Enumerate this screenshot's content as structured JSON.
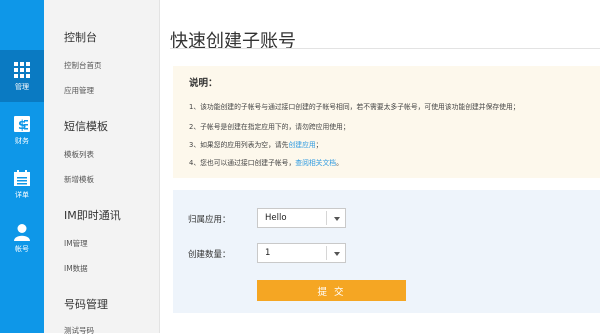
{
  "rail": {
    "items": [
      {
        "label": "管理",
        "icon": "grid-icon"
      },
      {
        "label": "财务",
        "icon": "dollar-icon"
      },
      {
        "label": "详单",
        "icon": "calendar-list-icon"
      },
      {
        "label": "帐号",
        "icon": "user-icon"
      }
    ]
  },
  "sidebar": {
    "sections": [
      {
        "title": "控制台",
        "links": [
          "控制台首页",
          "应用管理"
        ]
      },
      {
        "title": "短信模板",
        "links": [
          "模板列表",
          "新增模板"
        ]
      },
      {
        "title": "IM即时通讯",
        "links": [
          "IM管理",
          "IM数据"
        ]
      },
      {
        "title": "号码管理",
        "links": [
          "测试号码"
        ]
      }
    ]
  },
  "page": {
    "title": "快速创建子账号"
  },
  "notice": {
    "heading": "说明：",
    "line1": "1、该功能创建的子帐号与通过接口创建的子帐号相同，若不需要太多子帐号，可使用该功能创建并保存使用；",
    "line2": "2、子帐号是创建在指定应用下的，请勿跨应用使用；",
    "line3_prefix": "3、如果您的应用列表为空，请先",
    "line3_link": "创建应用",
    "line3_suffix": "；",
    "line4_prefix": "4、您也可以通过接口创建子帐号，",
    "line4_link": "查阅相关文档",
    "line4_suffix": "。"
  },
  "form": {
    "app_label": "归属应用：",
    "app_value": "Hello",
    "count_label": "创建数量：",
    "count_value": "1",
    "submit_label": "提 交"
  },
  "colors": {
    "rail_bg": "#0e97e8",
    "notice_bg": "#fdf8ec",
    "form_bg": "#eef4fb",
    "submit_bg": "#f5a623",
    "link": "#2e9ae0"
  }
}
